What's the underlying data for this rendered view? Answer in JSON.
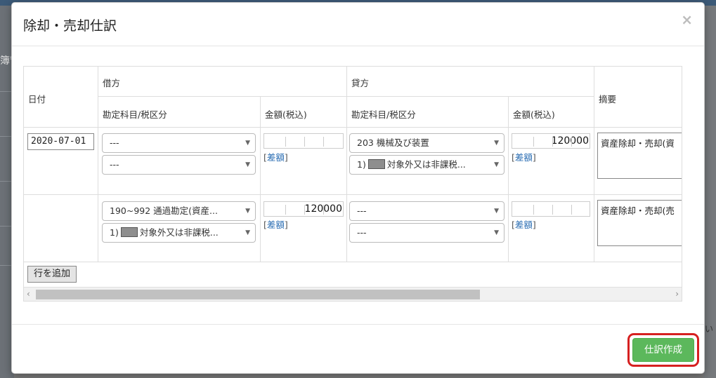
{
  "background": {
    "side_text": "簿管",
    "right_text": "い"
  },
  "modal": {
    "title": "除却・売却仕訳",
    "close_label": "×"
  },
  "table": {
    "headers": {
      "date": "日付",
      "debit": "借方",
      "credit": "貸方",
      "memo": "摘要",
      "account_tax": "勘定科目/税区分",
      "amount_tax_incl": "金額(税込)"
    },
    "rows": [
      {
        "date": "2020-07-01",
        "debit_account": "---",
        "debit_tax": "---",
        "debit_amount": "",
        "credit_account": "203 機械及び装置",
        "credit_tax_prefix": "1)",
        "credit_tax_suffix": "対象外又は非課税...",
        "credit_amount": "120000",
        "memo": "資産除却・売却(資"
      },
      {
        "debit_account": "190~992 通過勘定(資産...",
        "debit_tax_prefix": "1)",
        "debit_tax_suffix": "対象外又は非課税...",
        "debit_amount": "120000",
        "credit_account": "---",
        "credit_tax": "---",
        "credit_amount": "",
        "memo": "資産除却・売却(売"
      }
    ],
    "diff_link_open": "[",
    "diff_link_text": "差額",
    "diff_link_close": "]",
    "add_row_label": "行を追加"
  },
  "footer": {
    "submit_label": "仕訳作成",
    "highlight_color": "#d62020",
    "submit_color": "#5cb85c"
  }
}
